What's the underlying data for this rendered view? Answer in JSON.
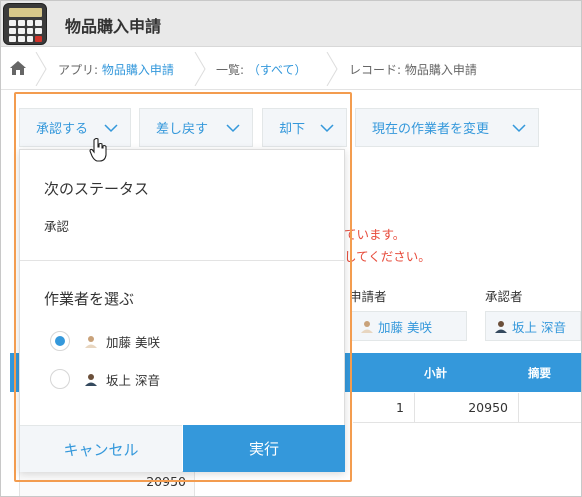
{
  "header": {
    "title": "物品購入申請"
  },
  "breadcrumb": {
    "app_prefix": "アプリ: ",
    "app_link": "物品購入申請",
    "list_prefix": "一覧: ",
    "list_link": "（すべて）",
    "record": "レコード: 物品購入申請"
  },
  "toolbar": {
    "approve": "承認する",
    "return": "差し戻す",
    "reject": "却下",
    "change_assignee": "現在の作業者を変更"
  },
  "record": {
    "error_line1": "ています。",
    "error_line2": "してください。",
    "applicant_label": "申請者",
    "applicant_name": "加藤 美咲",
    "approver_label": "承認者",
    "approver_name": "坂上 深音",
    "table_head_subtotal": "小計",
    "table_head_note": "摘要",
    "row_qty": "1",
    "row_subtotal": "20950",
    "total": "20950"
  },
  "panel": {
    "next_status_heading": "次のステータス",
    "next_status_value": "承認",
    "assignee_heading": "作業者を選ぶ",
    "options": [
      {
        "name": "加藤 美咲",
        "checked": true
      },
      {
        "name": "坂上 深音",
        "checked": false
      }
    ],
    "cancel": "キャンセル",
    "execute": "実行"
  },
  "colors": {
    "accent": "#3498db",
    "error": "#e74c3c",
    "highlight": "#f39c4f"
  },
  "icons": [
    "home-icon",
    "chevron-down-icon",
    "avatar-icon",
    "hand-cursor-icon",
    "app-calculator-icon"
  ]
}
